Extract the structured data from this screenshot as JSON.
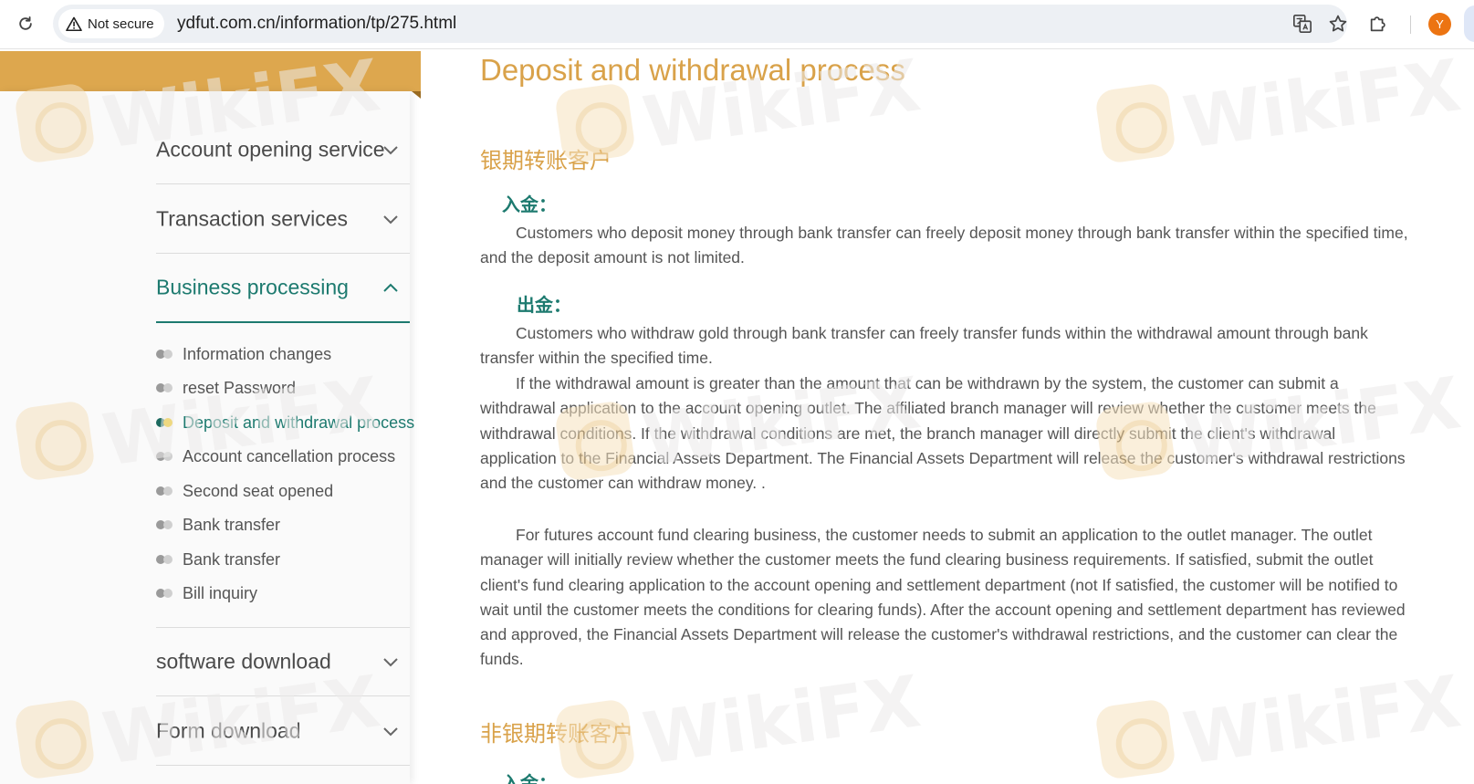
{
  "browser": {
    "security_label": "Not secure",
    "url": "ydfut.com.cn/information/tp/275.html",
    "avatar_letter": "Y"
  },
  "sidebar": {
    "sections": [
      {
        "label": "Account opening service",
        "state": "collapsed"
      },
      {
        "label": "Transaction services",
        "state": "collapsed"
      },
      {
        "label": "Business processing",
        "state": "expanded"
      },
      {
        "label": "software download",
        "state": "collapsed"
      },
      {
        "label": "Form download",
        "state": "collapsed"
      }
    ],
    "sub_items": [
      {
        "label": "Information changes"
      },
      {
        "label": "reset Password"
      },
      {
        "label": "Deposit and withdrawal process",
        "active": true
      },
      {
        "label": "Account cancellation process"
      },
      {
        "label": "Second seat opened"
      },
      {
        "label": "Bank transfer"
      },
      {
        "label": "Bank transfer"
      },
      {
        "label": "Bill inquiry"
      }
    ]
  },
  "content": {
    "title": "Deposit and withdrawal process",
    "section1_title": "银期转账客户",
    "deposit_label": "入金：",
    "deposit_text": "Customers who deposit money through bank transfer can freely deposit money through bank transfer within the specified time, and the deposit amount is not limited.",
    "withdraw_label": "出金：",
    "withdraw_text1": "Customers who withdraw gold through bank transfer can freely transfer funds within the withdrawal amount through bank transfer within the specified time.",
    "withdraw_text2": "If the withdrawal amount is greater than the amount that can be withdrawn by the system, the customer can submit a withdrawal application to the account opening outlet. The affiliated branch manager will review whether the customer meets the withdrawal conditions. If the withdrawal conditions are met, the branch manager will directly submit the client's withdrawal application to the Financial Assets Department. The Financial Assets Department will release the customer's withdrawal restrictions and the customer can withdraw money. .",
    "clearing_text": "For futures account fund clearing business, the customer needs to submit an application to the outlet manager. The outlet manager will initially review whether the customer meets the fund clearing business requirements. If satisfied, submit the outlet client's fund clearing application to the account opening and settlement department (not If satisfied, the customer will be notified to wait until the customer meets the conditions for clearing funds). After the account opening and settlement department has reviewed and approved, the Financial Assets Department will release the customer's withdrawal restrictions, and the customer can clear the funds.",
    "section2_title": "非银期转账客户",
    "section2_first_label": "入金："
  },
  "watermark": {
    "text": "WikiFX"
  },
  "colors": {
    "gold": "#d9a24a",
    "gold_bar": "#dda74e",
    "teal": "#1d7a6f",
    "text": "#555555"
  },
  "icons": {
    "reload": "reload-icon",
    "warning": "warning-triangle-icon",
    "translate": "translate-icon",
    "bookmark": "star-icon",
    "extensions": "puzzle-icon",
    "chevron_down": "chevron-down-icon",
    "chevron_up": "chevron-up-icon"
  }
}
